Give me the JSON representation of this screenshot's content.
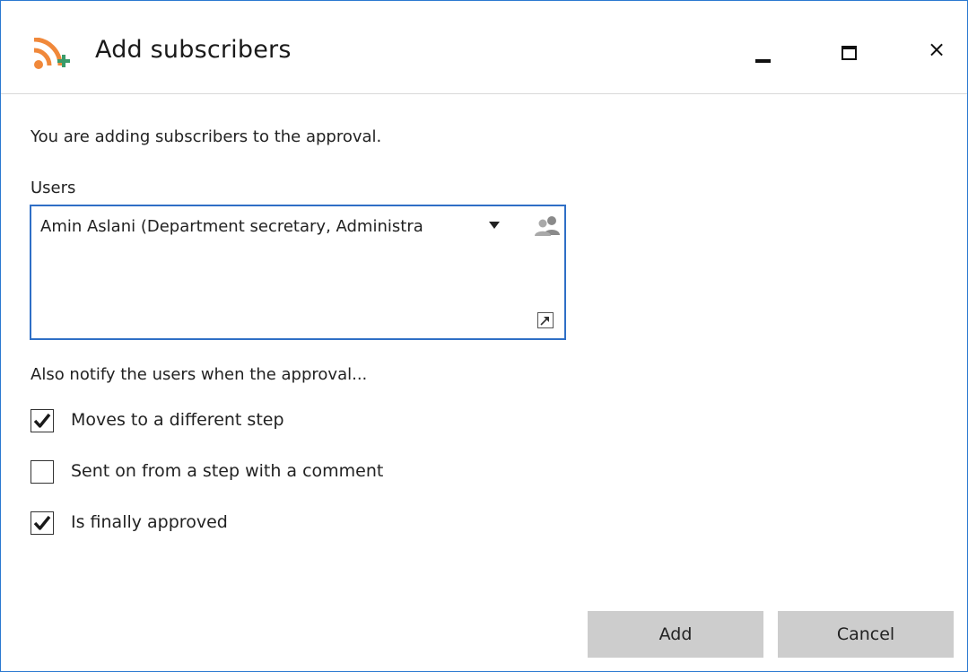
{
  "dialog": {
    "title": "Add subscribers",
    "icon": "rss-add-icon",
    "controls": {
      "minimize": "minimize-icon",
      "maximize": "maximize-icon",
      "close": "×"
    }
  },
  "main": {
    "intro": "You are adding subscribers to the approval.",
    "users_label": "Users",
    "selected_user": "Amin Aslani (Department secretary, Administra",
    "notify_label": "Also notify the users when the approval...",
    "options": [
      {
        "label": "Moves to a different step",
        "checked": true
      },
      {
        "label": "Sent on from a step with a comment",
        "checked": false
      },
      {
        "label": "Is finally approved",
        "checked": true
      }
    ]
  },
  "buttons": {
    "add": "Add",
    "cancel": "Cancel"
  },
  "colors": {
    "accent": "#2f6fc6",
    "rss_orange": "#f0883a",
    "plus_green": "#3a9b6a",
    "button_bg": "#cdcdcd"
  }
}
